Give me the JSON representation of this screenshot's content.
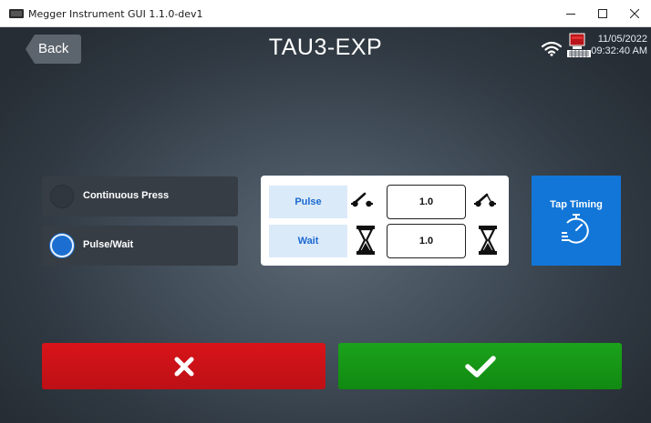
{
  "window": {
    "title": "Megger Instrument GUI 1.1.0-dev1"
  },
  "header": {
    "back_label": "Back",
    "title": "TAU3-EXP",
    "date": "11/05/2022",
    "time": "09:32:40 AM"
  },
  "mode_options": [
    {
      "label": "Continuous Press",
      "selected": false
    },
    {
      "label": "Pulse/Wait",
      "selected": true
    }
  ],
  "timing": {
    "pulse": {
      "label": "Pulse",
      "value": "1.0"
    },
    "wait": {
      "label": "Wait",
      "value": "1.0"
    }
  },
  "tap_timing_label": "Tap Timing",
  "colors": {
    "accent_blue": "#1276d8",
    "cancel_red": "#d81419",
    "confirm_green": "#1ba31b",
    "tag_background": "#dbeaf9"
  },
  "icons": {
    "cancel": "x-icon",
    "confirm": "check-icon",
    "pulse_left": "switch-open-icon",
    "pulse_right": "switch-closed-icon",
    "wait": "hourglass-icon",
    "tap_timing": "stopwatch-icon",
    "status": [
      "wifi-icon",
      "device-status-icon"
    ]
  }
}
